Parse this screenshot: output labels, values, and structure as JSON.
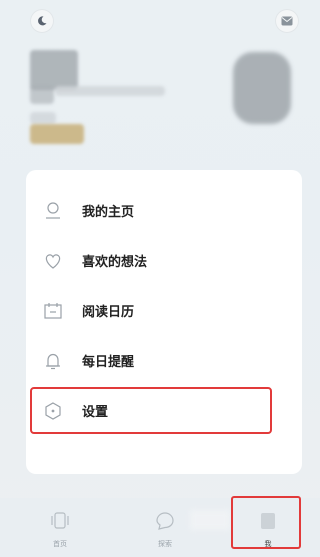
{
  "header": {
    "left_icon": "moon-icon",
    "right_icon": "mail-icon"
  },
  "menu": {
    "items": [
      {
        "label": "我的主页",
        "icon": "person-icon"
      },
      {
        "label": "喜欢的想法",
        "icon": "heart-icon"
      },
      {
        "label": "阅读日历",
        "icon": "calendar-icon"
      },
      {
        "label": "每日提醒",
        "icon": "bell-icon"
      },
      {
        "label": "设置",
        "icon": "settings-icon"
      }
    ],
    "highlighted_item": "设置"
  },
  "tabbar": {
    "tabs": [
      {
        "label": "首页",
        "icon": "home-icon"
      },
      {
        "label": "探索",
        "icon": "chat-icon"
      },
      {
        "label": "我",
        "icon": "profile-icon"
      }
    ],
    "active": "我"
  },
  "colors": {
    "highlight": "#e23a3a",
    "card": "#ffffff",
    "background": "#eaf0f3"
  }
}
